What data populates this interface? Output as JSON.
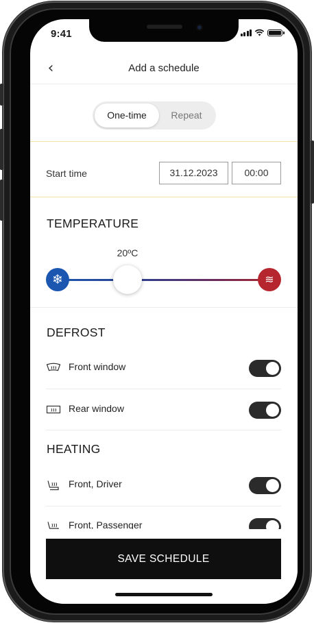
{
  "status_bar": {
    "time": "9:41"
  },
  "header": {
    "title": "Add a schedule",
    "back_icon": "‹"
  },
  "segmented": {
    "options": [
      "One-time",
      "Repeat"
    ],
    "selected": "One-time"
  },
  "start_time": {
    "label": "Start time",
    "date": "31.12.2023",
    "time": "00:00"
  },
  "temperature": {
    "title": "TEMPERATURE",
    "value": "20ºC",
    "cold_icon": "❄",
    "hot_icon": "≋",
    "gradient_start": "#1b56b0",
    "gradient_end": "#b6262e"
  },
  "defrost": {
    "title": "DEFROST",
    "items": [
      {
        "label": "Front window",
        "icon": "front-window-defrost-icon",
        "on": true
      },
      {
        "label": "Rear window",
        "icon": "rear-window-defrost-icon",
        "on": true
      }
    ]
  },
  "heating": {
    "title": "HEATING",
    "items": [
      {
        "label": "Front, Driver",
        "icon": "seat-heating-icon",
        "on": true
      },
      {
        "label": "Front, Passenger",
        "icon": "seat-heating-icon",
        "on": true
      }
    ]
  },
  "actions": {
    "save_label": "SAVE SCHEDULE"
  },
  "colors": {
    "accent": "#0f0f0f",
    "highlight_border": "#f3e1a6",
    "toggle_on": "#2b2b2b"
  }
}
